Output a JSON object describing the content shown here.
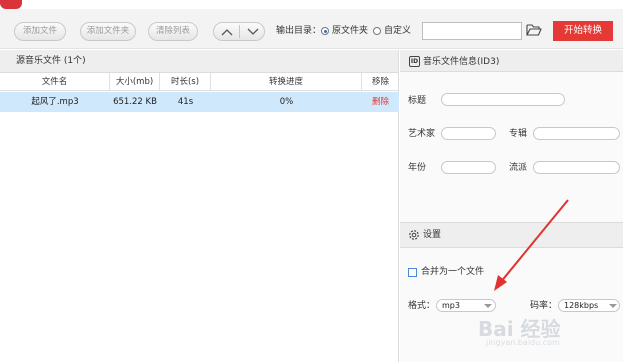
{
  "toolbar": {
    "add_file": "添加文件",
    "add_folder": "添加文件夹",
    "clear_list": "清除列表",
    "output_dir_label": "输出目录：",
    "radio_source_folder": "原文件夹",
    "radio_custom": "自定义",
    "output_path": "",
    "start_button": "开始转换"
  },
  "file_panel": {
    "title": "源音乐文件 (1个)",
    "columns": [
      "文件名",
      "大小(mb)",
      "时长(s)",
      "转换进度",
      "移除"
    ],
    "rows": [
      {
        "name": "起风了.mp3",
        "size": "651.22 KB",
        "duration": "41s",
        "progress": "0%",
        "remove": "删除"
      }
    ]
  },
  "info_panel": {
    "title": "音乐文件信息(ID3)",
    "title_icon": "ID",
    "fields": {
      "title": "标题",
      "artist": "艺术家",
      "album": "专辑",
      "year": "年份",
      "genre": "流派"
    }
  },
  "settings": {
    "title": "设置",
    "merge_label": "合并为一个文件",
    "merge_checked": false,
    "format_label": "格式：",
    "format_value": "mp3",
    "bitrate_label": "码率：",
    "bitrate_value": "128kbps"
  },
  "watermark": {
    "text": "Bai  经验",
    "url": "jingyan.baidu.com"
  },
  "colors": {
    "accent": "#e53935",
    "selection": "#cfe8fb",
    "arrow": "#e0322e",
    "remove": "#e53935"
  }
}
